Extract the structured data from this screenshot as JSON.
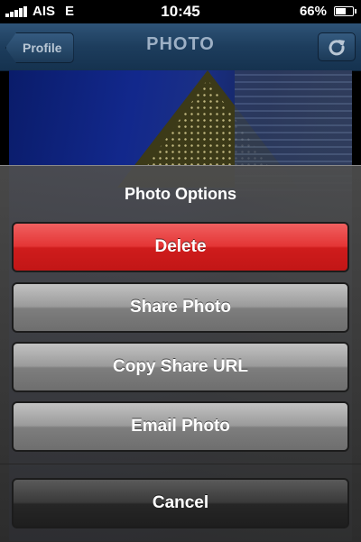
{
  "status_bar": {
    "carrier": "AIS",
    "network": "E",
    "time": "10:45",
    "battery_percent": "66%",
    "battery_level": 0.66
  },
  "nav": {
    "back_label": "Profile",
    "title": "PHOTO",
    "refresh_icon": "refresh-icon"
  },
  "action_sheet": {
    "title": "Photo Options",
    "buttons": [
      {
        "label": "Delete",
        "style": "destructive",
        "color": "#e43535"
      },
      {
        "label": "Share Photo",
        "style": "default"
      },
      {
        "label": "Copy Share URL",
        "style": "default"
      },
      {
        "label": "Email Photo",
        "style": "default"
      }
    ],
    "cancel_label": "Cancel"
  },
  "colors": {
    "nav_bar": "#1d3d5d",
    "destructive": "#e43535",
    "overlay": "#4e4e4e"
  }
}
